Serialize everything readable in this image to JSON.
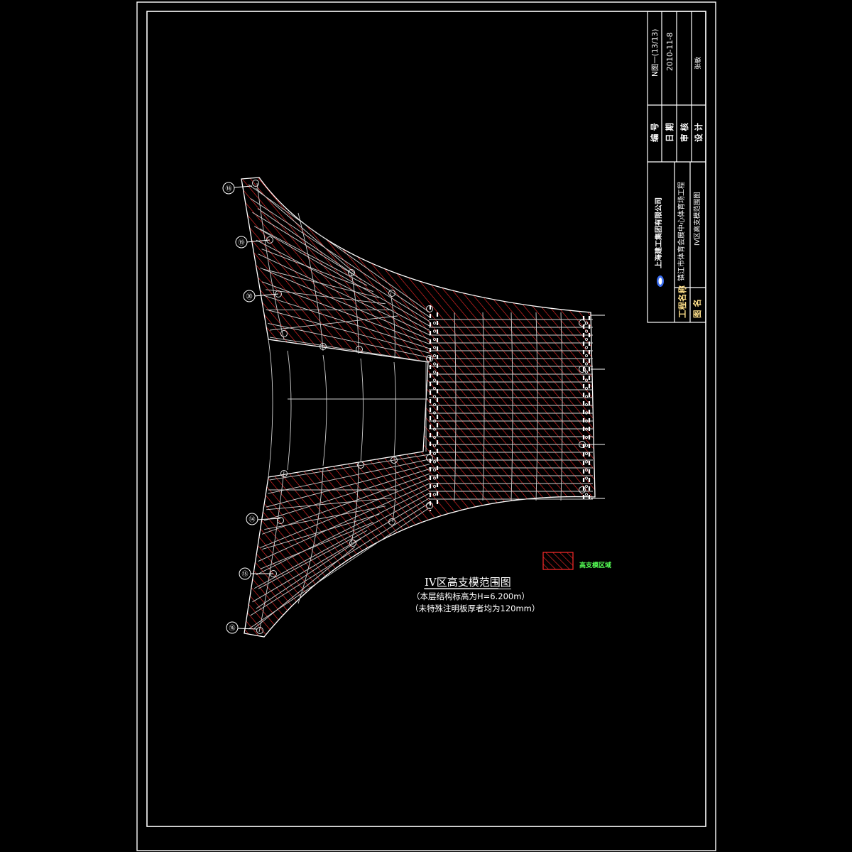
{
  "drawing": {
    "title": "IV区高支模范围图",
    "note_elevation": "（本层结构标高为H=6.200m）",
    "note_slab": "（未特殊注明板厚者均为120mm）",
    "legend_label": "高支模区域",
    "colors": {
      "background": "#000000",
      "frame": "#ffffff",
      "hatch": "#ff2a2a",
      "grid": "#cfcfcf",
      "legend_text": "#55ff55"
    }
  },
  "axis_bubbles": [
    "⑱",
    "⑲",
    "⑳",
    "⑭",
    "⑮",
    "⑯"
  ],
  "title_block": {
    "number_label": "编 号",
    "number_value": "N图一(13/13)",
    "date_label": "日 期",
    "date_value": "2010-11-8",
    "review_label": "审 核",
    "design_label": "设 计",
    "designer_value": "张敏",
    "company": "上海建工集团有限公司",
    "project_label": "工程名称",
    "project_value": "镇江市体育会展中心体育场工程",
    "drawing_name_label": "图 名",
    "drawing_name_value": "IV区高支模范围图"
  }
}
